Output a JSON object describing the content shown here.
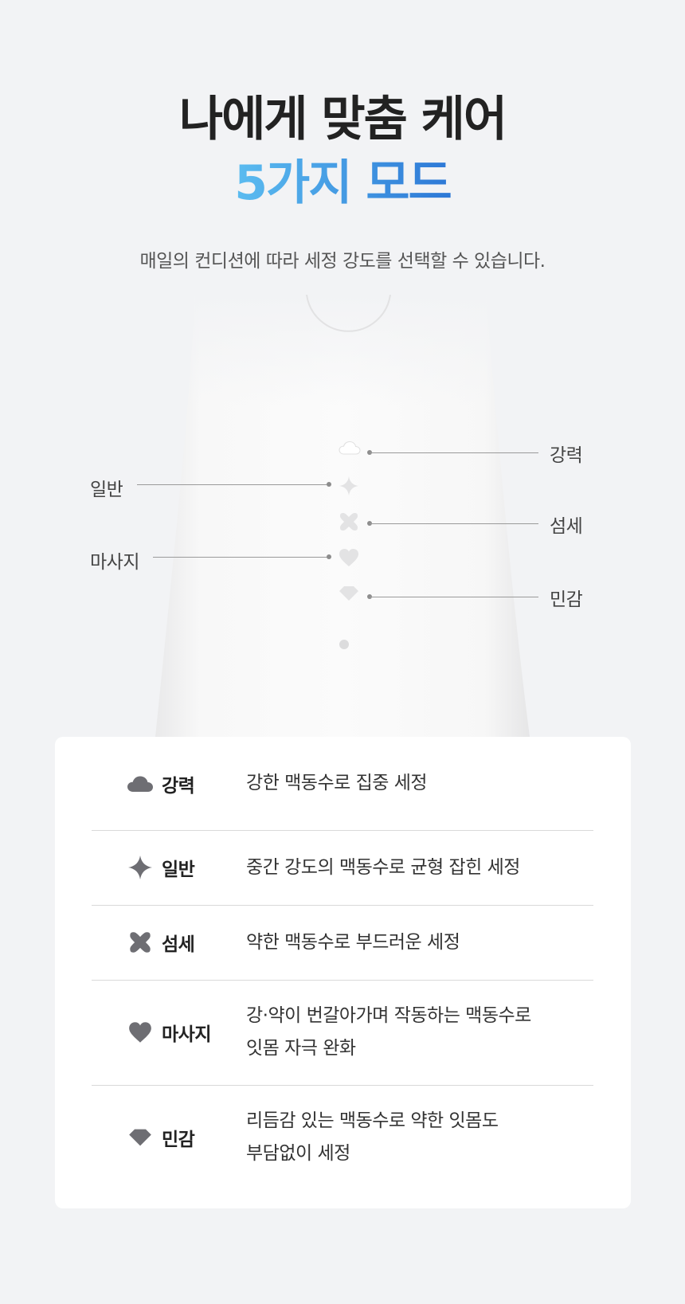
{
  "headline": {
    "line1": "나에게 맞춤 케어",
    "line2": "5가지 모드"
  },
  "subtitle": "매일의 컨디션에 따라 세정 강도를 선택할 수 있습니다.",
  "device_labels": {
    "strong": "강력",
    "normal": "일반",
    "delicate": "섬세",
    "massage": "마사지",
    "sensitive": "민감"
  },
  "modes": [
    {
      "icon": "cloud-icon",
      "name": "강력",
      "desc": [
        "강한 맥동수로 집중 세정"
      ]
    },
    {
      "icon": "sparkle-icon",
      "name": "일반",
      "desc": [
        "중간 강도의 맥동수로 균형 잡힌 세정"
      ]
    },
    {
      "icon": "cross-icon",
      "name": "섬세",
      "desc": [
        "약한 맥동수로 부드러운 세정"
      ]
    },
    {
      "icon": "heart-icon",
      "name": "마사지",
      "desc": [
        "강·약이 번갈아가며 작동하는 맥동수로",
        "잇몸 자극 완화"
      ]
    },
    {
      "icon": "diamond-icon",
      "name": "민감",
      "desc": [
        "리듬감 있는 맥동수로 약한 잇몸도",
        "부담없이 세정"
      ]
    }
  ],
  "colors": {
    "background": "#f2f3f5",
    "accent_start": "#5bbcf0",
    "accent_end": "#2d78d6",
    "icon_gray": "#6e6e73"
  }
}
